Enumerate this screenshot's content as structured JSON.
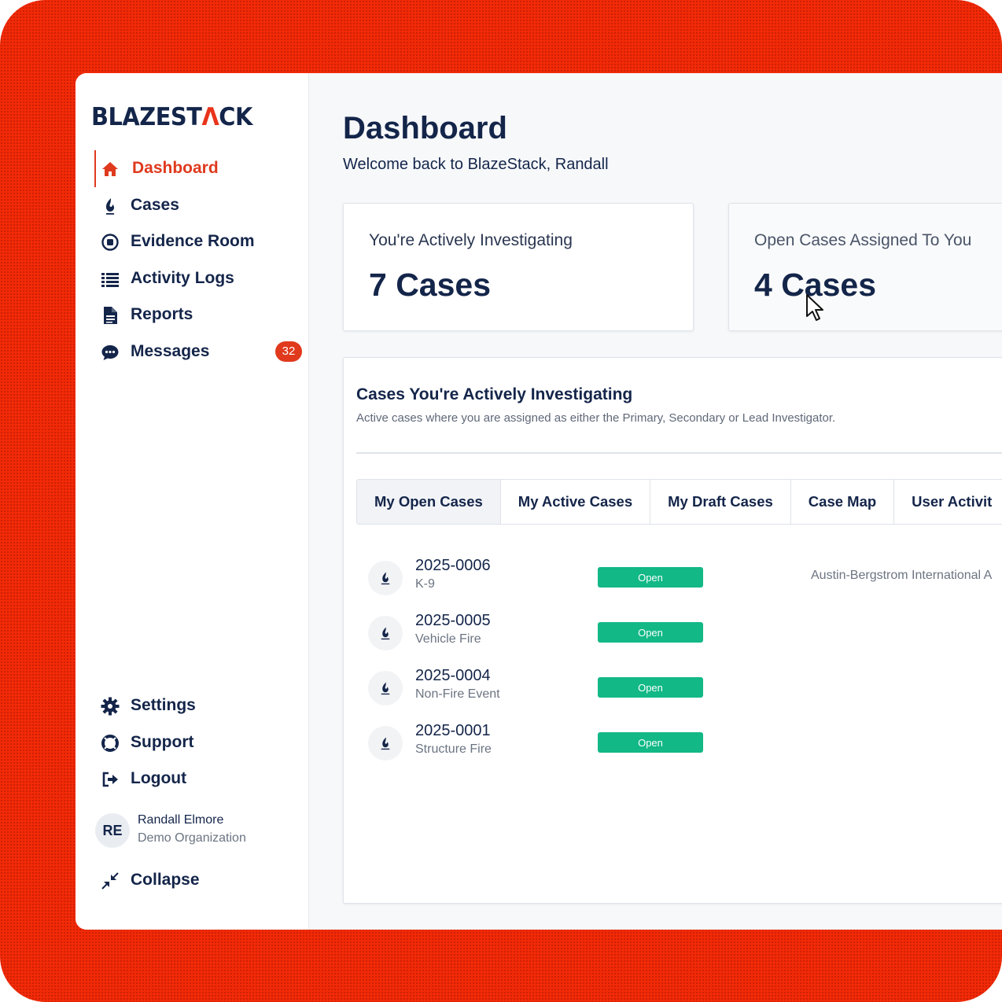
{
  "brand": {
    "logo_left": "BLAZEST",
    "logo_mark": "Λ",
    "logo_right": "CK"
  },
  "sidebar": {
    "items": [
      {
        "label": "Dashboard",
        "icon": "home-icon",
        "active": true
      },
      {
        "label": "Cases",
        "icon": "flame-icon"
      },
      {
        "label": "Evidence Room",
        "icon": "record-icon"
      },
      {
        "label": "Activity Logs",
        "icon": "list-icon"
      },
      {
        "label": "Reports",
        "icon": "document-icon"
      },
      {
        "label": "Messages",
        "icon": "chat-icon",
        "badge": "32"
      }
    ],
    "bottom_items": [
      {
        "label": "Settings",
        "icon": "gear-icon"
      },
      {
        "label": "Support",
        "icon": "lifebuoy-icon"
      },
      {
        "label": "Logout",
        "icon": "logout-icon"
      }
    ],
    "user": {
      "initials": "RE",
      "name": "Randall Elmore",
      "org": "Demo Organization"
    },
    "collapse_label": "Collapse"
  },
  "header": {
    "title": "Dashboard",
    "welcome": "Welcome back to BlazeStack, Randall"
  },
  "stats": [
    {
      "label": "You're Actively Investigating",
      "value": "7 Cases"
    },
    {
      "label": "Open Cases Assigned To You",
      "value": "4 Cases"
    }
  ],
  "panel": {
    "title": "Cases You're Actively Investigating",
    "subtitle": "Active cases where you are assigned as either the Primary, Secondary or Lead Investigator.",
    "tabs": [
      {
        "label": "My Open Cases",
        "active": true
      },
      {
        "label": "My Active Cases"
      },
      {
        "label": "My Draft Cases"
      },
      {
        "label": "Case Map"
      },
      {
        "label": "User Activit"
      }
    ],
    "cases": [
      {
        "id": "2025-0006",
        "type": "K-9",
        "status": "Open",
        "location": "Austin-Bergstrom International A"
      },
      {
        "id": "2025-0005",
        "type": "Vehicle Fire",
        "status": "Open",
        "location": ""
      },
      {
        "id": "2025-0004",
        "type": "Non-Fire Event",
        "status": "Open",
        "location": ""
      },
      {
        "id": "2025-0001",
        "type": "Structure Fire",
        "status": "Open",
        "location": ""
      }
    ]
  },
  "colors": {
    "accent": "#df3a1e",
    "navy": "#14254a",
    "status_open": "#12b886",
    "background": "#f22a07"
  }
}
